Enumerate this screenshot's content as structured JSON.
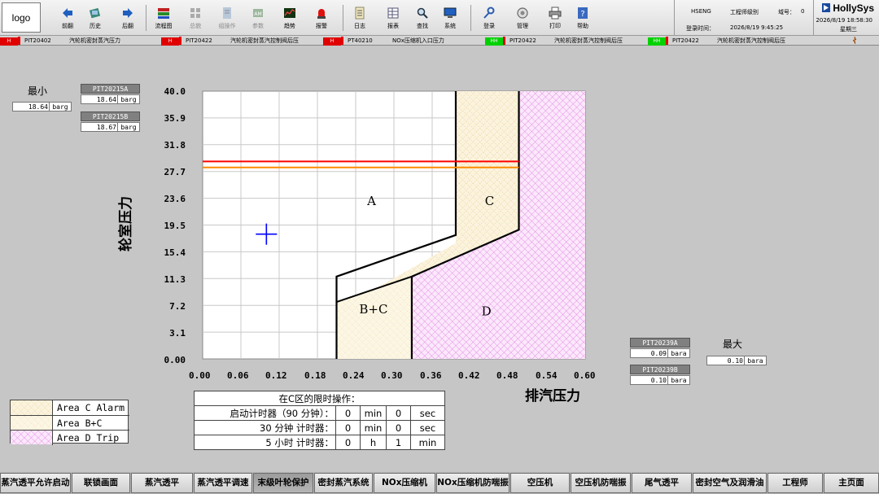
{
  "logo": "logo",
  "toolbar": [
    {
      "id": "prev",
      "label": "前翻",
      "icon": "arrow-left-icon",
      "disabled": false
    },
    {
      "id": "history",
      "label": "历史",
      "icon": "history-icon",
      "disabled": false
    },
    {
      "id": "next",
      "label": "后翻",
      "icon": "arrow-right-icon",
      "disabled": false
    },
    {
      "id": "flowchart",
      "label": "流程图",
      "icon": "flowchart-icon",
      "disabled": false
    },
    {
      "id": "overview",
      "label": "总貌",
      "icon": "overview-icon",
      "disabled": true
    },
    {
      "id": "group-op",
      "label": "组操作",
      "icon": "group-operation-icon",
      "disabled": true
    },
    {
      "id": "params",
      "label": "参数",
      "icon": "parameter-icon",
      "disabled": true
    },
    {
      "id": "trend",
      "label": "趋势",
      "icon": "trend-icon",
      "disabled": false
    },
    {
      "id": "alarm",
      "label": "报警",
      "icon": "alarm-light-icon",
      "disabled": false
    },
    {
      "id": "log",
      "label": "日志",
      "icon": "log-icon",
      "disabled": false
    },
    {
      "id": "report",
      "label": "报表",
      "icon": "report-icon",
      "disabled": false
    },
    {
      "id": "search",
      "label": "查找",
      "icon": "search-icon",
      "disabled": false
    },
    {
      "id": "system",
      "label": "系统",
      "icon": "monitor-icon",
      "disabled": false
    },
    {
      "id": "login",
      "label": "登录",
      "icon": "key-icon",
      "disabled": false
    },
    {
      "id": "manage",
      "label": "管理",
      "icon": "manage-icon",
      "disabled": false
    },
    {
      "id": "print",
      "label": "打印",
      "icon": "printer-icon",
      "disabled": false
    },
    {
      "id": "help",
      "label": "帮助",
      "icon": "help-icon",
      "disabled": false
    }
  ],
  "user": {
    "name": "HSENG",
    "level": "工程师级别",
    "domain_label": "域号：",
    "domain_value": "0",
    "login_label": "登录时间：",
    "login_time": "2026/8/19 9:45:25"
  },
  "brand": {
    "name": "HollySys",
    "datetime": "2026/8/19 18:58:30",
    "weekday": "星期三"
  },
  "alarms": [
    {
      "level": "H",
      "tag": "PIT20402",
      "desc": "汽轮机密封蒸汽压力"
    },
    {
      "level": "H",
      "tag": "PIT20422",
      "desc": "汽轮机密封蒸汽控制阀后压"
    },
    {
      "level": "H",
      "tag": "PT40210",
      "desc": "NOx压缩机入口压力"
    },
    {
      "level": "HH",
      "tag": "PIT20422",
      "desc": "汽轮机密封蒸汽控制阀后压"
    },
    {
      "level": "HH",
      "tag": "PIT20422",
      "desc": "汽轮机密封蒸汽控制阀后压"
    }
  ],
  "min_panel": {
    "label": "最小",
    "value": "18.64",
    "unit": "barg",
    "sensors": [
      {
        "tag": "PIT20215A",
        "value": "18.64",
        "unit": "barg"
      },
      {
        "tag": "PIT20215B",
        "value": "18.67",
        "unit": "barg"
      }
    ]
  },
  "max_panel": {
    "label": "最大",
    "value": "0.10",
    "unit": "bara",
    "sensors": [
      {
        "tag": "PIT20239A",
        "value": "0.09",
        "unit": "bara"
      },
      {
        "tag": "PIT20239B",
        "value": "0.10",
        "unit": "bara"
      }
    ]
  },
  "chart_data": {
    "type": "area",
    "xlabel": "排汽压力",
    "ylabel": "轮室压力",
    "xlim": [
      0.0,
      0.6
    ],
    "ylim": [
      0.0,
      40.0
    ],
    "x_ticks": [
      "0.00",
      "0.06",
      "0.12",
      "0.18",
      "0.24",
      "0.30",
      "0.36",
      "0.42",
      "0.48",
      "0.54",
      "0.60"
    ],
    "y_ticks": [
      "40.0",
      "35.9",
      "31.8",
      "27.7",
      "23.6",
      "19.5",
      "15.4",
      "11.3",
      "7.2",
      "3.1",
      "0.00"
    ],
    "regions": [
      {
        "name": "A",
        "label_at": [
          0.265,
          23.0
        ]
      },
      {
        "name": "C",
        "label_at": [
          0.45,
          23.0
        ],
        "polygon": [
          [
            0.397,
            40.0
          ],
          [
            0.496,
            40.0
          ],
          [
            0.496,
            19.3
          ],
          [
            0.397,
            8.5
          ],
          [
            0.21,
            3.5
          ],
          [
            0.21,
            7.2
          ],
          [
            0.397,
            17.3
          ]
        ]
      },
      {
        "name": "B+C",
        "label_at": [
          0.268,
          6.8
        ],
        "polygon": [
          [
            0.21,
            0.0
          ],
          [
            0.328,
            0.0
          ],
          [
            0.328,
            12.3
          ],
          [
            0.21,
            8.5
          ]
        ]
      },
      {
        "name": "D",
        "label_at": [
          0.445,
          6.5
        ],
        "polygon": [
          [
            0.328,
            0.0
          ],
          [
            0.6,
            0.0
          ],
          [
            0.6,
            40.0
          ],
          [
            0.496,
            40.0
          ],
          [
            0.496,
            19.3
          ],
          [
            0.328,
            12.3
          ]
        ]
      }
    ],
    "boundary": [
      [
        0.21,
        0.0
      ],
      [
        0.21,
        12.3
      ],
      [
        0.397,
        18.5
      ],
      [
        0.397,
        40.0
      ]
    ],
    "boundary_cd": [
      [
        0.328,
        0.0
      ],
      [
        0.328,
        12.3
      ],
      [
        0.496,
        19.3
      ],
      [
        0.496,
        40.0
      ]
    ],
    "alarm_lines": [
      {
        "y": 29.5,
        "color": "#ff0000"
      },
      {
        "y": 28.6,
        "color": "#ff8c00"
      }
    ],
    "operating_point": {
      "x": 0.1,
      "y": 18.64,
      "color": "#0000ff"
    },
    "colors": {
      "area_c": "#f3deb0",
      "area_bc": "#f7ecc8",
      "area_d": "#e98be6",
      "grid": "#c8c8c8"
    }
  },
  "c_table": {
    "title": "在C区的限时操作：",
    "rows": [
      {
        "label": "启动计时器（90 分钟）：",
        "v1": "0",
        "u1": "min",
        "v2": "0",
        "u2": "sec"
      },
      {
        "label": "30 分钟  计时器：",
        "v1": "0",
        "u1": "min",
        "v2": "0",
        "u2": "sec"
      },
      {
        "label": "5  小时  计时器：",
        "v1": "0",
        "u1": "h",
        "v2": "1",
        "u2": "min"
      }
    ]
  },
  "legend": [
    {
      "label": "Area C Alarm",
      "pattern": "c"
    },
    {
      "label": "Area B+C",
      "pattern": "bc"
    },
    {
      "label": "Area D  Trip",
      "pattern": "d"
    }
  ],
  "nav": [
    {
      "label": "蒸汽透平允许启动",
      "active": false
    },
    {
      "label": "联锁画面",
      "active": false
    },
    {
      "label": "蒸汽透平",
      "active": false
    },
    {
      "label": "蒸汽透平调速",
      "active": false
    },
    {
      "label": "末级叶轮保护",
      "active": true
    },
    {
      "label": "密封蒸汽系统",
      "active": false
    },
    {
      "label": "NOx压缩机",
      "active": false
    },
    {
      "label": "NOx压缩机防喘振",
      "active": false
    },
    {
      "label": "空压机",
      "active": false
    },
    {
      "label": "空压机防喘振",
      "active": false
    },
    {
      "label": "尾气透平",
      "active": false
    },
    {
      "label": "密封空气及润滑油",
      "active": false
    },
    {
      "label": "工程师",
      "active": false
    },
    {
      "label": "主页面",
      "active": false
    }
  ]
}
